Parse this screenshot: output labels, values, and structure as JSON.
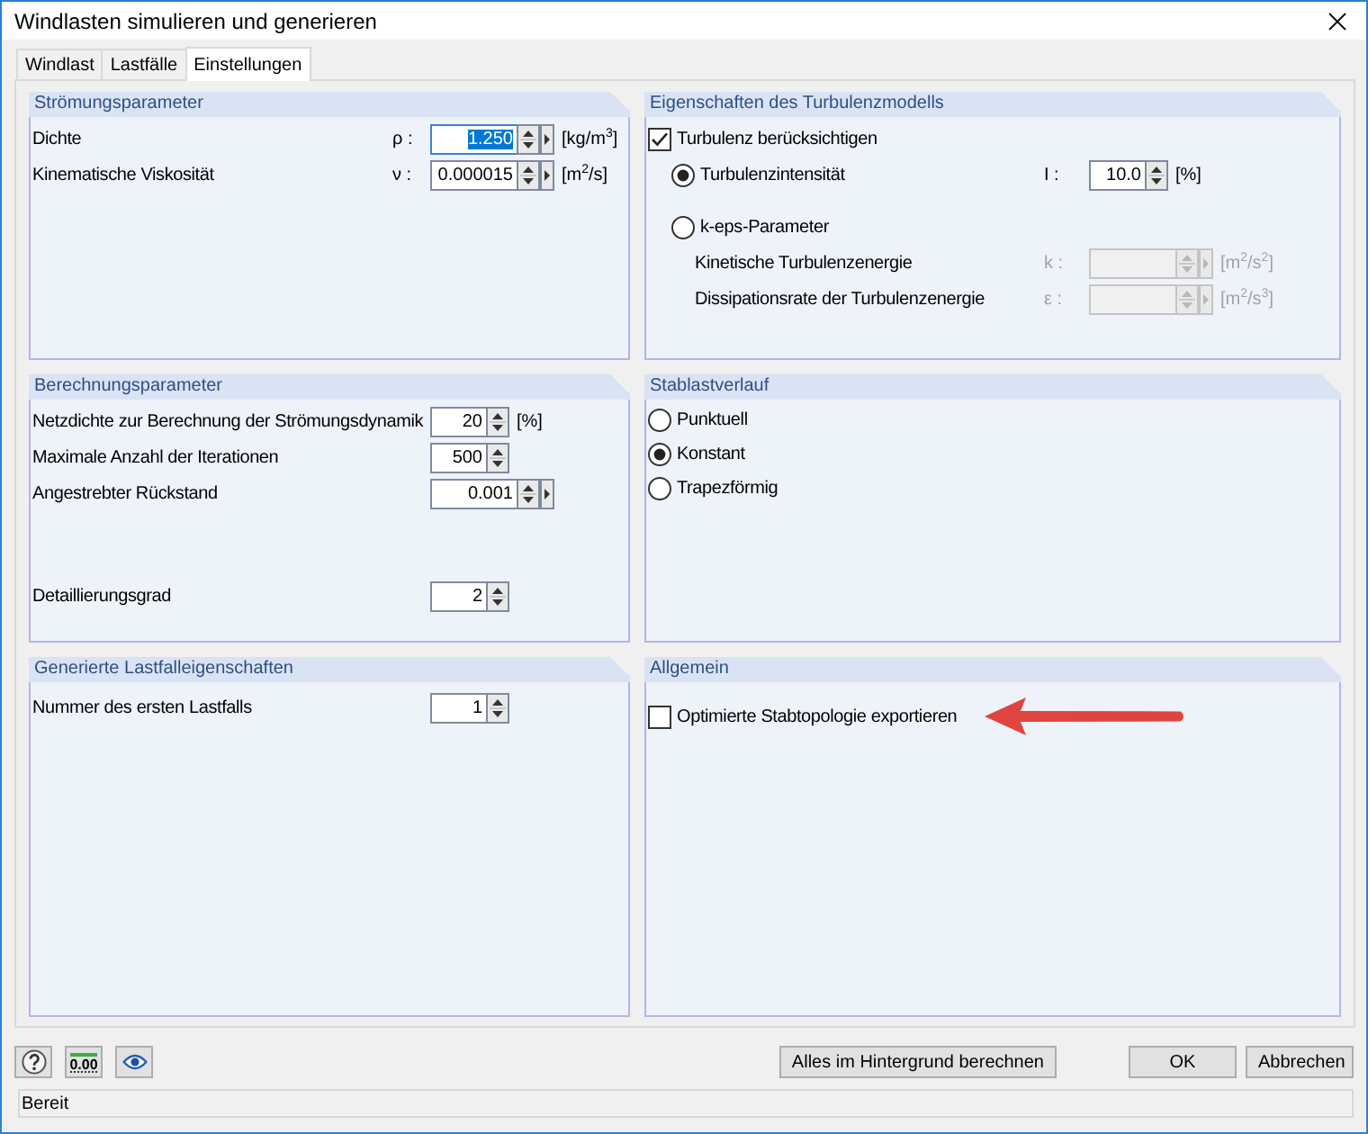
{
  "window": {
    "title": "Windlasten simulieren und generieren"
  },
  "tabs": [
    {
      "label": "Windlast",
      "selected": false
    },
    {
      "label": "Lastfälle",
      "selected": false
    },
    {
      "label": "Einstellungen",
      "selected": true
    }
  ],
  "panels": [
    {
      "title": "Strömungsparameter",
      "rows": [
        {
          "kind": "field",
          "label": "Dichte",
          "symbol": "ρ :",
          "value": "1.250",
          "unit": "[kg/m$^{3}$]",
          "menu_button": true,
          "focused": true,
          "disabled": false
        },
        {
          "kind": "field",
          "label": "Kinematische Viskosität",
          "symbol": "ν :",
          "value": "0.000015",
          "unit": "[m$^{2}$/s]",
          "menu_button": true,
          "focused": false,
          "disabled": false
        }
      ]
    },
    {
      "title": "Eigenschaften des Turbulenzmodells",
      "rows": [
        {
          "kind": "checkbox",
          "label": "Turbulenz berücksichtigen",
          "checked": true,
          "children": [
            {
              "kind": "radio",
              "label": "Turbulenzintensität",
              "selected": true,
              "field": {
                "symbol": "I :",
                "value": "10.0",
                "unit": "[%]",
                "menu_button": false,
                "focused": false,
                "disabled": false
              }
            },
            {
              "kind": "radio",
              "label": "k-eps-Parameter",
              "selected": false,
              "children": [
                {
                  "kind": "field",
                  "label": "Kinetische Turbulenzenergie",
                  "symbol": "k :",
                  "unit": "[m$^{2}$/s$^{2}$]",
                  "menu_button": true,
                  "focused": false,
                  "disabled": true
                },
                {
                  "kind": "field",
                  "label": "Dissipationsrate der Turbulenzenergie",
                  "symbol": "ε :",
                  "unit": "[m$^{2}$/s$^{3}$]",
                  "menu_button": true,
                  "focused": false,
                  "disabled": true
                }
              ]
            }
          ]
        }
      ]
    },
    {
      "title": "Berechnungsparameter",
      "rows": [
        {
          "kind": "field",
          "label": "Netzdichte zur Berechnung der Strömungsdynamik",
          "value": "20",
          "unit": "[%]",
          "menu_button": false,
          "focused": false,
          "disabled": false
        },
        {
          "kind": "field",
          "label": "Maximale Anzahl der Iterationen",
          "value": "500",
          "menu_button": false,
          "focused": false,
          "disabled": false
        },
        {
          "kind": "field",
          "label": "Angestrebter Rückstand",
          "value": "0.001",
          "menu_button": true,
          "focused": false,
          "disabled": false
        },
        {
          "kind": "field",
          "label": "Detaillierungsgrad",
          "value": "2",
          "menu_button": false,
          "focused": false,
          "disabled": false
        }
      ]
    },
    {
      "title": "Stablastverlauf",
      "rows": [
        {
          "kind": "radio",
          "label": "Punktuell",
          "selected": false
        },
        {
          "kind": "radio",
          "label": "Konstant",
          "selected": true
        },
        {
          "kind": "radio",
          "label": "Trapezförmig",
          "selected": false
        }
      ]
    },
    {
      "title": "Generierte Lastfalleigenschaften",
      "rows": [
        {
          "kind": "field",
          "label": "Nummer des ersten Lastfalls",
          "value": "1",
          "menu_button": false,
          "focused": false,
          "disabled": false
        }
      ]
    },
    {
      "title": "Allgemein",
      "rows": [
        {
          "kind": "checkbox",
          "label": "Optimierte Stabtopologie exportieren",
          "checked": false
        }
      ]
    }
  ],
  "toolbar": [
    {
      "kind": "help"
    },
    {
      "kind": "decimals",
      "label": "0.00"
    },
    {
      "kind": "view"
    }
  ],
  "buttons": [
    "Alles im Hintergrund berechnen",
    "OK",
    "Abbrechen"
  ],
  "status_bar": {
    "text": "Bereit"
  }
}
